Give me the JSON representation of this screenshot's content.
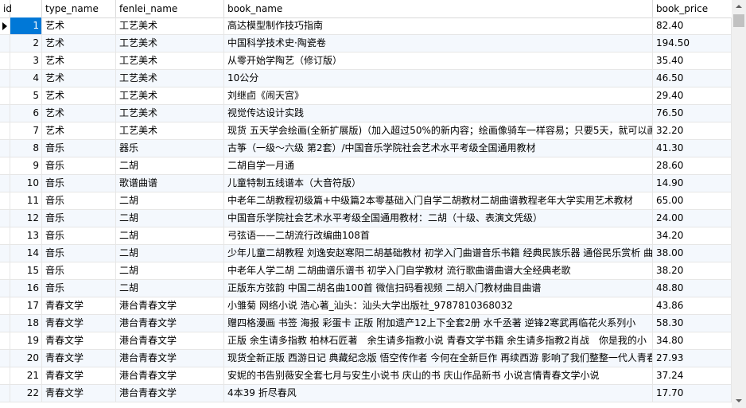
{
  "columns": {
    "id": "id",
    "type_name": "type_name",
    "fenlei_name": "fenlei_name",
    "book_name": "book_name",
    "book_price": "book_price"
  },
  "selected_row_index": 0,
  "rows": [
    {
      "id": "1",
      "type_name": "艺术",
      "fenlei_name": "工艺美术",
      "book_name": "高达模型制作技巧指南",
      "book_price": "82.40"
    },
    {
      "id": "2",
      "type_name": "艺术",
      "fenlei_name": "工艺美术",
      "book_name": "中国科学技术史·陶瓷卷",
      "book_price": "194.50"
    },
    {
      "id": "3",
      "type_name": "艺术",
      "fenlei_name": "工艺美术",
      "book_name": "从零开始学陶艺（修订版）",
      "book_price": "35.40"
    },
    {
      "id": "4",
      "type_name": "艺术",
      "fenlei_name": "工艺美术",
      "book_name": "10公分",
      "book_price": "46.50"
    },
    {
      "id": "5",
      "type_name": "艺术",
      "fenlei_name": "工艺美术",
      "book_name": "刘继卣《闹天宫》",
      "book_price": "29.40"
    },
    {
      "id": "6",
      "type_name": "艺术",
      "fenlei_name": "工艺美术",
      "book_name": "视觉传达设计实践",
      "book_price": "76.50"
    },
    {
      "id": "7",
      "type_name": "艺术",
      "fenlei_name": "工艺美术",
      "book_name": "现货 五天学会绘画(全新扩展版)（加入超过50%的新内容；绘画像骑车一样容易；只要5天，就可以画",
      "book_price": "32.20"
    },
    {
      "id": "8",
      "type_name": "音乐",
      "fenlei_name": "器乐",
      "book_name": "古筝（一级～六级 第2套）/中国音乐学院社会艺术水平考级全国通用教材",
      "book_price": "41.30"
    },
    {
      "id": "9",
      "type_name": "音乐",
      "fenlei_name": "二胡",
      "book_name": "二胡自学一月通",
      "book_price": "28.60"
    },
    {
      "id": "10",
      "type_name": "音乐",
      "fenlei_name": "歌谱曲谱",
      "book_name": "儿童特制五线谱本（大音符版）",
      "book_price": "14.90"
    },
    {
      "id": "11",
      "type_name": "音乐",
      "fenlei_name": "二胡",
      "book_name": "中老年二胡教程初级篇+中级篇2本零基础入门自学二胡教材二胡曲谱教程老年大学实用艺术教材",
      "book_price": "65.00"
    },
    {
      "id": "12",
      "type_name": "音乐",
      "fenlei_name": "二胡",
      "book_name": "中国音乐学院社会艺术水平考级全国通用教材：二胡（十级、表演文凭级）",
      "book_price": "24.00"
    },
    {
      "id": "13",
      "type_name": "音乐",
      "fenlei_name": "二胡",
      "book_name": "弓弦语——二胡流行改编曲108首",
      "book_price": "34.20"
    },
    {
      "id": "14",
      "type_name": "音乐",
      "fenlei_name": "二胡",
      "book_name": "少年儿童二胡教程 刘逸安赵寒阳二胡基础教材 初学入门曲谱音乐书籍 经典民族乐器 通俗民乐赏析 曲",
      "book_price": "38.00"
    },
    {
      "id": "15",
      "type_name": "音乐",
      "fenlei_name": "二胡",
      "book_name": "中老年人学二胡 二胡曲谱乐谱书 初学入门自学教材 流行歌曲谱曲谱大全经典老歌",
      "book_price": "38.20"
    },
    {
      "id": "16",
      "type_name": "音乐",
      "fenlei_name": "二胡",
      "book_name": "正版东方弦韵 中国二胡名曲100首 微信扫码看视频 二胡入门教材曲目曲谱",
      "book_price": "48.80"
    },
    {
      "id": "17",
      "type_name": "青春文学",
      "fenlei_name": "港台青春文学",
      "book_name": "小雏菊 网络小说 浩心著_汕头：汕头大学出版社_9787810368032",
      "book_price": "43.86"
    },
    {
      "id": "18",
      "type_name": "青春文学",
      "fenlei_name": "港台青春文学",
      "book_name": "赠四格漫画 书签 海报 彩蛋卡 正版 附加遗产12上下全套2册 水千丞著 逆锋2寒武再临花火系列小",
      "book_price": "58.30"
    },
    {
      "id": "19",
      "type_name": "青春文学",
      "fenlei_name": "港台青春文学",
      "book_name": "正版 余生请多指教 柏林石匠著　余生请多指教小说 青春文学书籍 余生请多指教2肖战　你是我的小",
      "book_price": "34.80"
    },
    {
      "id": "20",
      "type_name": "青春文学",
      "fenlei_name": "港台青春文学",
      "book_name": "现货全新正版 西游日记 典藏纪念版 悟空传作者 今何在全新巨作 再续西游 影响了我们整整一代人青春",
      "book_price": "27.93"
    },
    {
      "id": "21",
      "type_name": "青春文学",
      "fenlei_name": "港台青春文学",
      "book_name": "安妮的书告别薇安全套七月与安生小说书 庆山的书 庆山作品新书 小说言情青春文学小说",
      "book_price": "37.24"
    },
    {
      "id": "22",
      "type_name": "青春文学",
      "fenlei_name": "港台青春文学",
      "book_name": "4本39 折尽春风",
      "book_price": "17.70"
    }
  ]
}
